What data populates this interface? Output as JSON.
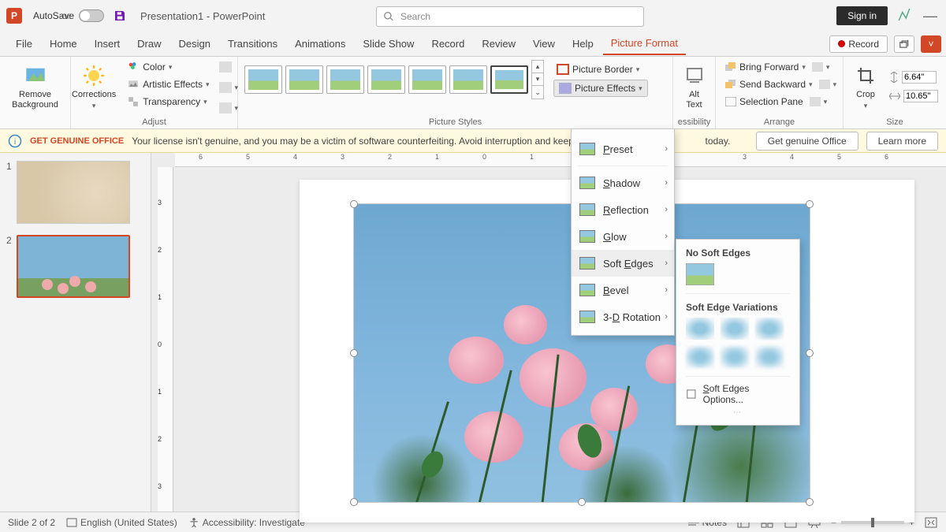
{
  "titlebar": {
    "autosave_label": "AutoSave",
    "autosave_state": "Off",
    "doc_title": "Presentation1  -  PowerPoint",
    "search_placeholder": "Search",
    "signin": "Sign in"
  },
  "tabs": {
    "items": [
      "File",
      "Home",
      "Insert",
      "Draw",
      "Design",
      "Transitions",
      "Animations",
      "Slide Show",
      "Record",
      "Review",
      "View",
      "Help",
      "Picture Format"
    ],
    "active_index": 12,
    "record_button": "Record"
  },
  "ribbon": {
    "remove_bg": "Remove\nBackground",
    "corrections": "Corrections",
    "color": "Color",
    "artistic": "Artistic Effects",
    "transparency": "Transparency",
    "adjust_title": "Adjust",
    "styles_title": "Picture Styles",
    "picture_border": "Picture Border",
    "picture_effects": "Picture Effects",
    "alt_text": "Alt\nText",
    "accessibility_title": "essibility",
    "bring_forward": "Bring Forward",
    "send_backward": "Send Backward",
    "selection_pane": "Selection Pane",
    "arrange_title": "Arrange",
    "crop": "Crop",
    "size_title": "Size",
    "height": "6.64\"",
    "width": "10.65\""
  },
  "msgbar": {
    "title": "GET GENUINE OFFICE",
    "text": "Your license isn't genuine, and you may be a victim of software counterfeiting. Avoid interruption and keep your",
    "trail": "today.",
    "btn1": "Get genuine Office",
    "btn2": "Learn more"
  },
  "effects_menu": {
    "items": [
      "Preset",
      "Shadow",
      "Reflection",
      "Glow",
      "Soft Edges",
      "Bevel",
      "3-D Rotation"
    ],
    "hover_index": 4
  },
  "soft_menu": {
    "no_edges": "No Soft Edges",
    "variations": "Soft Edge Variations",
    "options": "Soft Edges Options..."
  },
  "thumbnails": {
    "slides": [
      1,
      2
    ],
    "selected": 2
  },
  "statusbar": {
    "slide": "Slide 2 of 2",
    "lang": "English (United States)",
    "access": "Accessibility: Investigate",
    "notes": "Notes"
  }
}
